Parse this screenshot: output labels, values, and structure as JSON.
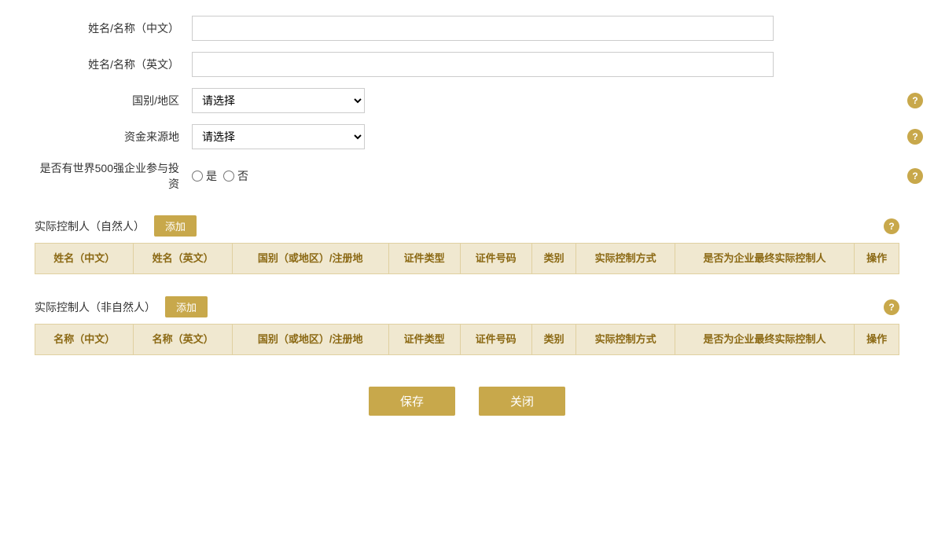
{
  "form": {
    "name_cn_label": "姓名/名称（中文）",
    "name_en_label": "姓名/名称（英文）",
    "country_label": "国别/地区",
    "fund_source_label": "资金来源地",
    "fortune500_label": "是否有世界500强企业参与投资",
    "country_placeholder": "请选择",
    "fund_source_placeholder": "请选择",
    "radio_yes": "是",
    "radio_no": "否"
  },
  "natural_person_section": {
    "title": "实际控制人（自然人）",
    "add_button": "添加",
    "columns": [
      "姓名（中文）",
      "姓名（英文）",
      "国别（或地区）/注册地",
      "证件类型",
      "证件号码",
      "类别",
      "实际控制方式",
      "是否为企业最终实际控制人",
      "操作"
    ]
  },
  "non_natural_person_section": {
    "title": "实际控制人（非自然人）",
    "add_button": "添加",
    "columns": [
      "名称（中文）",
      "名称（英文）",
      "国别（或地区）/注册地",
      "证件类型",
      "证件号码",
      "类别",
      "实际控制方式",
      "是否为企业最终实际控制人",
      "操作"
    ]
  },
  "buttons": {
    "save": "保存",
    "close": "关闭"
  },
  "help_icon_text": "?"
}
